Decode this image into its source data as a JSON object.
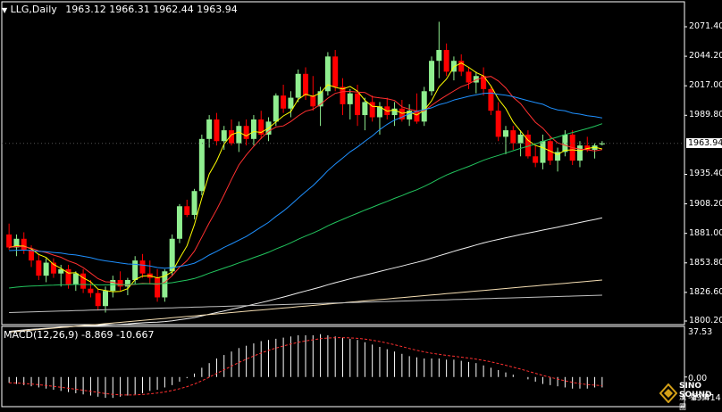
{
  "header": {
    "symbol": "LLG,Daily",
    "ohlc": "1963.12 1966.31 1962.44 1963.94",
    "menu_icon": "triangle-down-icon"
  },
  "price_axis": {
    "labels": [
      "2071.40",
      "2044.20",
      "2017.00",
      "1989.80",
      "1963.94",
      "1935.40",
      "1908.20",
      "1881.00",
      "1853.80",
      "1826.60",
      "1800.20"
    ],
    "current_price": "1963.94"
  },
  "macd": {
    "label": "MACD(12,26,9) -8.869 -10.667",
    "axis_top": "37.53",
    "axis_zero": "0.00",
    "axis_bottom": "-19.414"
  },
  "logo": {
    "line1": "SINO SOUND",
    "line2": "漢 聲 集 團",
    "icon": "diamond-logo-icon"
  },
  "colors": {
    "bull": "#90ee90",
    "bear": "#ff0000",
    "ma5": "#ffff00",
    "ma10": "#ff3030",
    "ma30": "#1e90ff",
    "ma60": "#22c55e",
    "ma120": "#f0f0f0",
    "ma250": "#f5deb3",
    "macd_signal": "#ff3030"
  },
  "chart_data": {
    "type": "candlestick",
    "ylim": [
      1800.2,
      2071.4
    ],
    "candles": [
      [
        1880,
        1890,
        1866,
        1868
      ],
      [
        1868,
        1880,
        1860,
        1876
      ],
      [
        1876,
        1882,
        1862,
        1866
      ],
      [
        1866,
        1870,
        1850,
        1856
      ],
      [
        1856,
        1862,
        1838,
        1842
      ],
      [
        1842,
        1858,
        1836,
        1854
      ],
      [
        1854,
        1858,
        1840,
        1844
      ],
      [
        1844,
        1852,
        1832,
        1848
      ],
      [
        1848,
        1852,
        1830,
        1834
      ],
      [
        1834,
        1846,
        1828,
        1844
      ],
      [
        1844,
        1848,
        1826,
        1830
      ],
      [
        1830,
        1838,
        1822,
        1826
      ],
      [
        1826,
        1830,
        1810,
        1814
      ],
      [
        1814,
        1832,
        1808,
        1828
      ],
      [
        1828,
        1842,
        1822,
        1838
      ],
      [
        1838,
        1846,
        1828,
        1832
      ],
      [
        1832,
        1840,
        1824,
        1838
      ],
      [
        1838,
        1860,
        1834,
        1856
      ],
      [
        1856,
        1862,
        1840,
        1844
      ],
      [
        1844,
        1856,
        1834,
        1840
      ],
      [
        1840,
        1848,
        1818,
        1822
      ],
      [
        1822,
        1848,
        1818,
        1846
      ],
      [
        1846,
        1880,
        1842,
        1876
      ],
      [
        1876,
        1908,
        1872,
        1906
      ],
      [
        1906,
        1912,
        1896,
        1898
      ],
      [
        1898,
        1922,
        1894,
        1920
      ],
      [
        1920,
        1972,
        1916,
        1968
      ],
      [
        1968,
        1990,
        1960,
        1986
      ],
      [
        1986,
        1992,
        1962,
        1966
      ],
      [
        1966,
        1980,
        1958,
        1976
      ],
      [
        1976,
        1986,
        1962,
        1964
      ],
      [
        1964,
        1984,
        1956,
        1980
      ],
      [
        1980,
        1986,
        1962,
        1968
      ],
      [
        1968,
        1990,
        1962,
        1986
      ],
      [
        1986,
        1994,
        1968,
        1972
      ],
      [
        1972,
        1988,
        1966,
        1984
      ],
      [
        1984,
        2010,
        1980,
        2008
      ],
      [
        2008,
        2018,
        1992,
        1996
      ],
      [
        1996,
        2012,
        1988,
        2006
      ],
      [
        2006,
        2032,
        2002,
        2028
      ],
      [
        2028,
        2034,
        2004,
        2008
      ],
      [
        2008,
        2026,
        1994,
        1998
      ],
      [
        1998,
        2016,
        1980,
        2012
      ],
      [
        2012,
        2048,
        2008,
        2044
      ],
      [
        2044,
        2050,
        2012,
        2016
      ],
      [
        2016,
        2024,
        1990,
        2000
      ],
      [
        2000,
        2014,
        1986,
        2010
      ],
      [
        2010,
        2018,
        1980,
        1990
      ],
      [
        1990,
        2006,
        1976,
        2002
      ],
      [
        2002,
        2008,
        1984,
        1988
      ],
      [
        1988,
        2002,
        1972,
        1998
      ],
      [
        1998,
        2006,
        1986,
        1990
      ],
      [
        1990,
        2002,
        1980,
        1996
      ],
      [
        1996,
        2004,
        1984,
        1986
      ],
      [
        1986,
        2000,
        1980,
        1994
      ],
      [
        1994,
        2010,
        1982,
        1984
      ],
      [
        1984,
        2016,
        1980,
        2012
      ],
      [
        2012,
        2044,
        2008,
        2040
      ],
      [
        2040,
        2076,
        2024,
        2050
      ],
      [
        2050,
        2056,
        2026,
        2030
      ],
      [
        2030,
        2044,
        2022,
        2040
      ],
      [
        2040,
        2046,
        2026,
        2030
      ],
      [
        2030,
        2034,
        2014,
        2020
      ],
      [
        2020,
        2030,
        2010,
        2026
      ],
      [
        2026,
        2034,
        2008,
        2014
      ],
      [
        2014,
        2016,
        1990,
        1994
      ],
      [
        1994,
        2002,
        1966,
        1970
      ],
      [
        1970,
        1980,
        1954,
        1976
      ],
      [
        1976,
        1980,
        1958,
        1964
      ],
      [
        1964,
        1976,
        1952,
        1972
      ],
      [
        1972,
        1976,
        1950,
        1952
      ],
      [
        1952,
        1962,
        1942,
        1946
      ],
      [
        1946,
        1972,
        1940,
        1966
      ],
      [
        1966,
        1970,
        1944,
        1948
      ],
      [
        1948,
        1960,
        1938,
        1956
      ],
      [
        1956,
        1976,
        1952,
        1972
      ],
      [
        1972,
        1976,
        1944,
        1948
      ],
      [
        1948,
        1966,
        1942,
        1962
      ],
      [
        1962,
        1970,
        1956,
        1958
      ],
      [
        1958,
        1964,
        1950,
        1962
      ],
      [
        1963,
        1966,
        1962,
        1964
      ]
    ],
    "macd_hist": [
      -5,
      -6,
      -7,
      -8,
      -9,
      -10,
      -11,
      -12,
      -13,
      -14,
      -15,
      -16,
      -17,
      -18,
      -18,
      -17,
      -16,
      -15,
      -14,
      -12,
      -11,
      -9,
      -7,
      -4,
      -1,
      3,
      8,
      12,
      16,
      19,
      22,
      25,
      27,
      29,
      31,
      32,
      33,
      34,
      35,
      36,
      36,
      36,
      37,
      36,
      35,
      34,
      33,
      32,
      30,
      28,
      26,
      24,
      22,
      20,
      18,
      17,
      16,
      16,
      16,
      15,
      15,
      14,
      13,
      12,
      10,
      8,
      6,
      4,
      2,
      0,
      -2,
      -4,
      -6,
      -7,
      -8,
      -9,
      -10,
      -10,
      -10,
      -9,
      -9
    ]
  }
}
